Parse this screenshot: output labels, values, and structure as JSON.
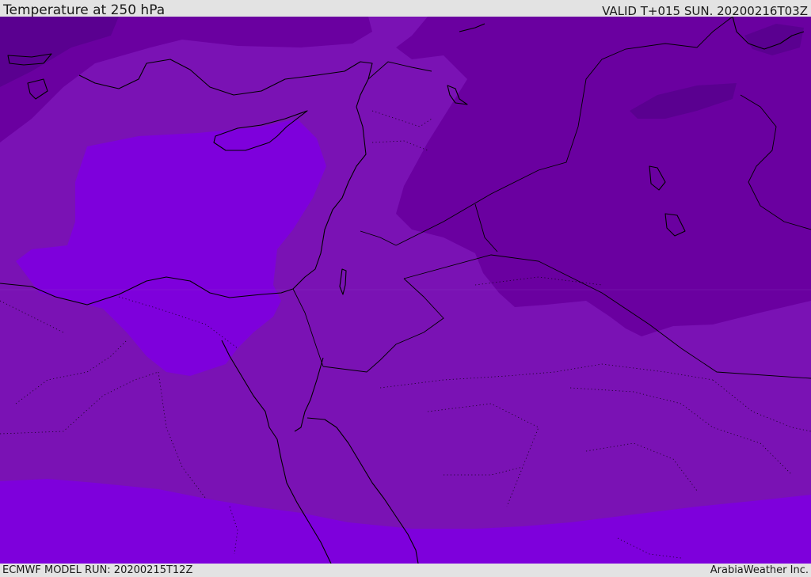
{
  "header": {
    "title": "Temperature at 250 hPa",
    "valid": "VALID T+015 SUN. 20200216T03Z"
  },
  "footer": {
    "model_run": "ECMWF MODEL RUN: 20200215T12Z",
    "credit": "ArabiaWeather Inc."
  },
  "colors": {
    "band_coldest": "#5a0090",
    "band_cold": "#6a00a0",
    "band_mid": "#7a12b4",
    "band_warm": "#7e00dc",
    "coastline": "#000000"
  }
}
